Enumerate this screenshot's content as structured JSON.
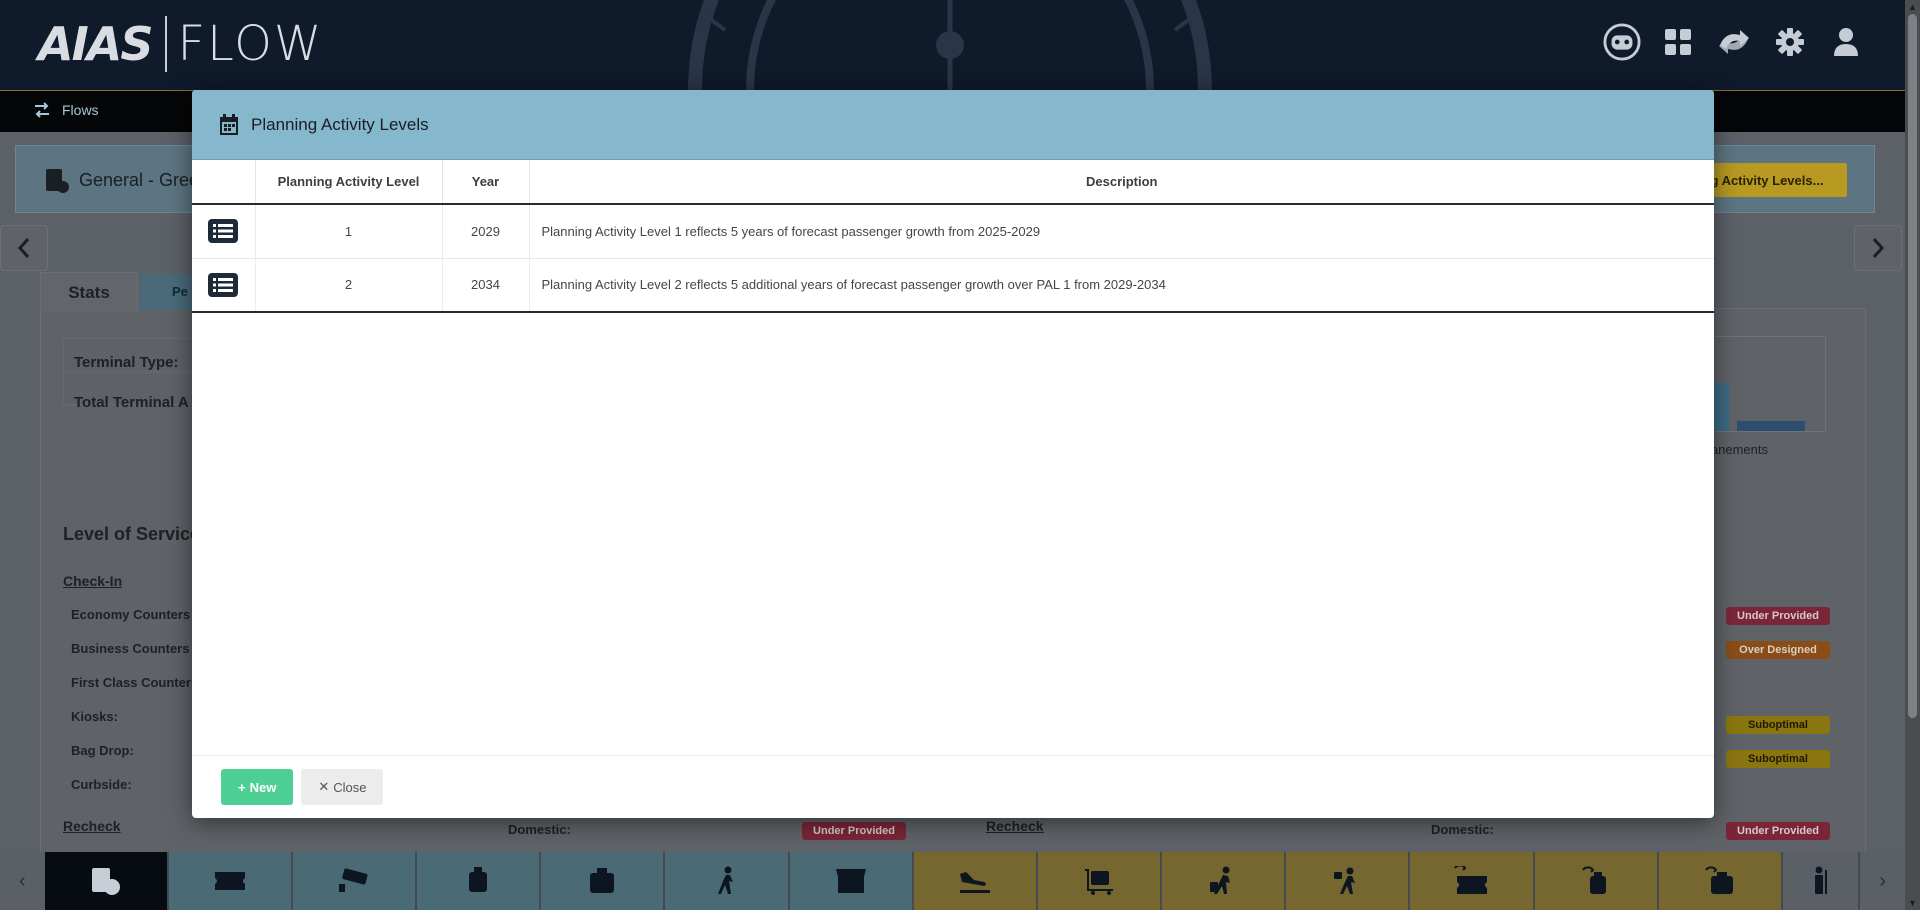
{
  "header": {
    "brand_left": "AIAS",
    "brand_right": "FLOW",
    "icons": [
      "robot-icon",
      "grid-icon",
      "transfer-icon",
      "gear-icon",
      "user-icon"
    ]
  },
  "nav": {
    "flows_label": "Flows"
  },
  "page": {
    "title": "General - Gree",
    "pal_button": "ning Activity Levels...",
    "tabs": [
      "Stats",
      "Pe"
    ],
    "terminal_type_label": "Terminal Type:",
    "total_terminal_label": "Total Terminal A",
    "level_of_service": "Level of Service",
    "checkin_link": "Check-In",
    "rows": [
      "Economy Counters",
      "Business Counters",
      "First Class Counter",
      "Kiosks:",
      "Bag Drop:",
      "Curbside:"
    ],
    "recheck_link": "Recheck",
    "domestic_label": "Domestic:",
    "chart_label": "lanements",
    "badges": {
      "under": "Under Provided",
      "over": "Over Designed",
      "sub": "Suboptimal"
    }
  },
  "modal": {
    "title": "Planning Activity Levels",
    "columns": [
      "",
      "Planning Activity Level",
      "Year",
      "Description"
    ],
    "rows": [
      {
        "level": "1",
        "year": "2029",
        "description": "Planning Activity Level 1 reflects 5 years of forecast passenger growth from 2025-2029"
      },
      {
        "level": "2",
        "year": "2034",
        "description": "Planning Activity Level 2 reflects 5 additional years of forecast passenger growth over PAL 1 from 2029-2034"
      }
    ],
    "new_button": "New",
    "close_button": "Close"
  },
  "dock": {
    "items": [
      "flow-info-icon",
      "ticket-icon",
      "security-camera-icon",
      "luggage-icon",
      "suitcase-icon",
      "walking-icon",
      "store-icon",
      "plane-landing-icon",
      "baggage-cart-icon",
      "traveler-icon",
      "lock-walk-icon",
      "reticket-icon",
      "rebag-icon",
      "resuitcase-icon",
      "restroom-icon"
    ]
  },
  "colors": {
    "modal_header": "#85b8cc",
    "new_button": "#4ed094",
    "header_bg": "#0f1a2b"
  }
}
